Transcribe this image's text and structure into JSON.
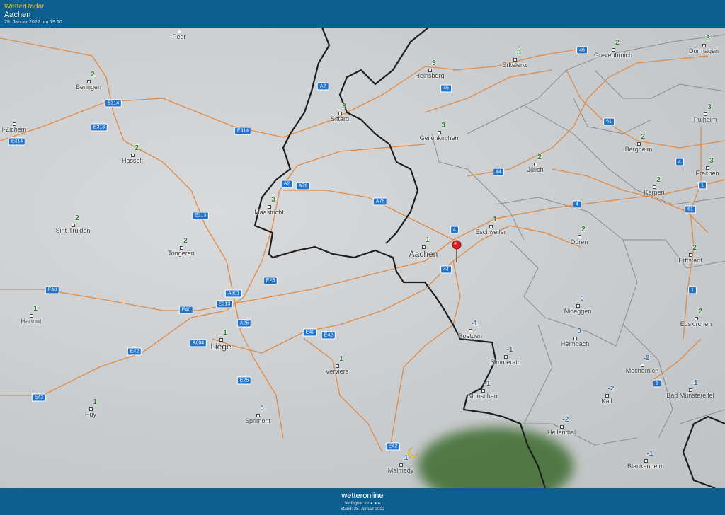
{
  "header": {
    "app_title": "WetterRadar",
    "location": "Aachen",
    "timestamp": "25. Januar 2022 um 19:10"
  },
  "footer": {
    "brand": "wetteronline",
    "availability": "Verfügbar für ● ● ●",
    "stand": "Stand: 25. Januar 2022"
  },
  "colors": {
    "header_bg": "#0d5f8f",
    "road": "#e08a45",
    "border": "#1e1e1e",
    "shield": "#2273c9",
    "precip": "#3e6b2e"
  },
  "cities": [
    {
      "name": "Peer",
      "temp": ""
    },
    {
      "name": "Beringen",
      "temp": "2"
    },
    {
      "name": "i-Zichem",
      "temp": ""
    },
    {
      "name": "Hasselt",
      "temp": "2"
    },
    {
      "name": "Sint-Truiden",
      "temp": "2"
    },
    {
      "name": "Tongeren",
      "temp": "2"
    },
    {
      "name": "Hannut",
      "temp": "1"
    },
    {
      "name": "Liège",
      "temp": "1",
      "big": true
    },
    {
      "name": "Huy",
      "temp": "1"
    },
    {
      "name": "Sprimont",
      "temp": "0"
    },
    {
      "name": "Verviers",
      "temp": "1"
    },
    {
      "name": "Malmedy",
      "temp": "-1"
    },
    {
      "name": "Maastricht",
      "temp": "3"
    },
    {
      "name": "Sittard",
      "temp": "3"
    },
    {
      "name": "Heinsberg",
      "temp": "3"
    },
    {
      "name": "Geilenkirchen",
      "temp": "3"
    },
    {
      "name": "Erkelenz",
      "temp": "3"
    },
    {
      "name": "Aachen",
      "temp": "1",
      "big": true
    },
    {
      "name": "Eschweiler",
      "temp": "1"
    },
    {
      "name": "Jülich",
      "temp": "2"
    },
    {
      "name": "Roetgen",
      "temp": "-1"
    },
    {
      "name": "Simmerath",
      "temp": "-1"
    },
    {
      "name": "Monschau",
      "temp": "-1"
    },
    {
      "name": "Grevenbroich",
      "temp": "2"
    },
    {
      "name": "Dormagen",
      "temp": "3"
    },
    {
      "name": "Pulheim",
      "temp": "3"
    },
    {
      "name": "Bergheim",
      "temp": "2"
    },
    {
      "name": "Frechen",
      "temp": "3"
    },
    {
      "name": "Kerpen",
      "temp": "2"
    },
    {
      "name": "Erftstadt",
      "temp": "2"
    },
    {
      "name": "Düren",
      "temp": "2"
    },
    {
      "name": "Nideggen",
      "temp": "0"
    },
    {
      "name": "Heimbach",
      "temp": "0"
    },
    {
      "name": "Euskirchen",
      "temp": "2"
    },
    {
      "name": "Mechernich",
      "temp": "-2"
    },
    {
      "name": "Kall",
      "temp": "-2"
    },
    {
      "name": "Bad Münstereifel",
      "temp": "-1"
    },
    {
      "name": "Hellenthal",
      "temp": "-2"
    },
    {
      "name": "Blankenheim",
      "temp": "-1"
    }
  ],
  "road_shields": [
    "E314",
    "E313",
    "E314",
    "E314",
    "E313",
    "E40",
    "E40",
    "E313",
    "A601",
    "E25",
    "A25",
    "A604",
    "E42",
    "E42",
    "E25",
    "E42",
    "E40",
    "E42",
    "A2",
    "A2",
    "A79",
    "A76",
    "4",
    "44",
    "44",
    "61",
    "4",
    "4",
    "1",
    "61",
    "46",
    "46",
    "1",
    "1"
  ]
}
